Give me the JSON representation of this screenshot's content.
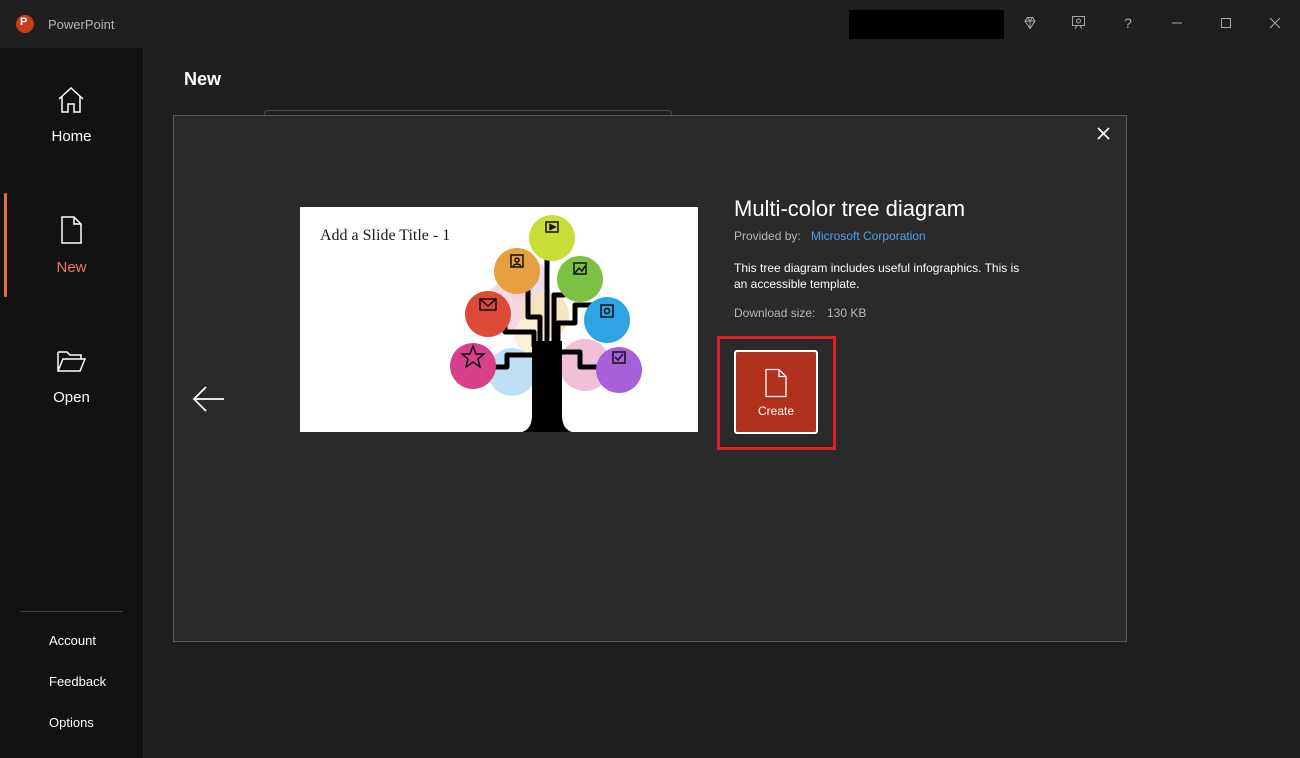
{
  "app": {
    "name": "PowerPoint",
    "logo_letter": "P"
  },
  "sidebar": {
    "items": [
      {
        "label": "Home",
        "icon": "home-icon"
      },
      {
        "label": "New",
        "icon": "new-document-icon",
        "active": true
      },
      {
        "label": "Open",
        "icon": "folder-open-icon"
      }
    ],
    "links": [
      "Account",
      "Feedback",
      "Options"
    ]
  },
  "main": {
    "title": "New"
  },
  "dialog": {
    "preview_title": "Add a Slide Title - 1",
    "template_title": "Multi-color tree diagram",
    "provided_label": "Provided by:",
    "provider": "Microsoft Corporation",
    "description": "This tree diagram includes useful infographics. This is an accessible template.",
    "download_label": "Download size:",
    "download_value": "130 KB",
    "create_label": "Create"
  },
  "titlebar": {
    "help_label": "?"
  },
  "colors": {
    "accent": "#e8775b",
    "create_button": "#b2301e",
    "highlight_border": "#e01f26",
    "link": "#4aa3e8"
  }
}
